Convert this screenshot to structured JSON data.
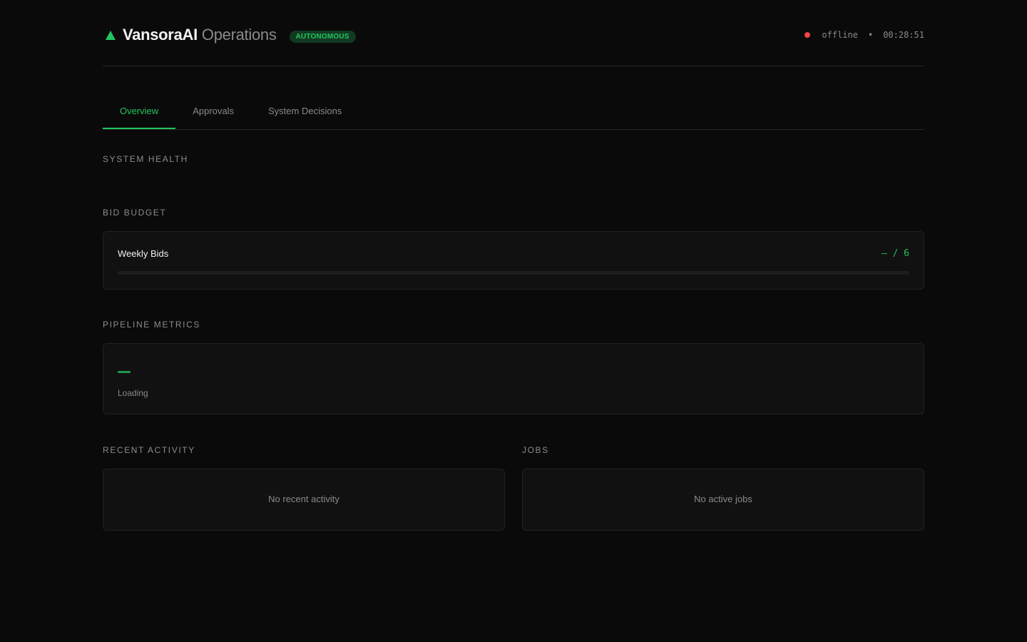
{
  "header": {
    "brand_name": "VansoraAI",
    "brand_sub": "Operations",
    "badge": "AUTONOMOUS",
    "status_text": "offline",
    "separator": "•",
    "clock": "00:28:51",
    "logo_icon": "triangle-up-icon",
    "status_color": "#ef4444",
    "accent_color": "#22c55e"
  },
  "tabs": [
    {
      "label": "Overview",
      "active": true
    },
    {
      "label": "Approvals",
      "active": false
    },
    {
      "label": "System Decisions",
      "active": false
    }
  ],
  "sections": {
    "system_health": "SYSTEM HEALTH",
    "bid_budget": "BID BUDGET",
    "pipeline_metrics": "PIPELINE METRICS",
    "recent_activity": "RECENT ACTIVITY",
    "jobs": "JOBS"
  },
  "budget": {
    "label": "Weekly Bids",
    "value": "– / 6",
    "progress_fraction": 0
  },
  "pipeline": {
    "loading_text": "Loading"
  },
  "recent_activity": {
    "empty_text": "No recent activity"
  },
  "jobs": {
    "empty_text": "No active jobs"
  }
}
